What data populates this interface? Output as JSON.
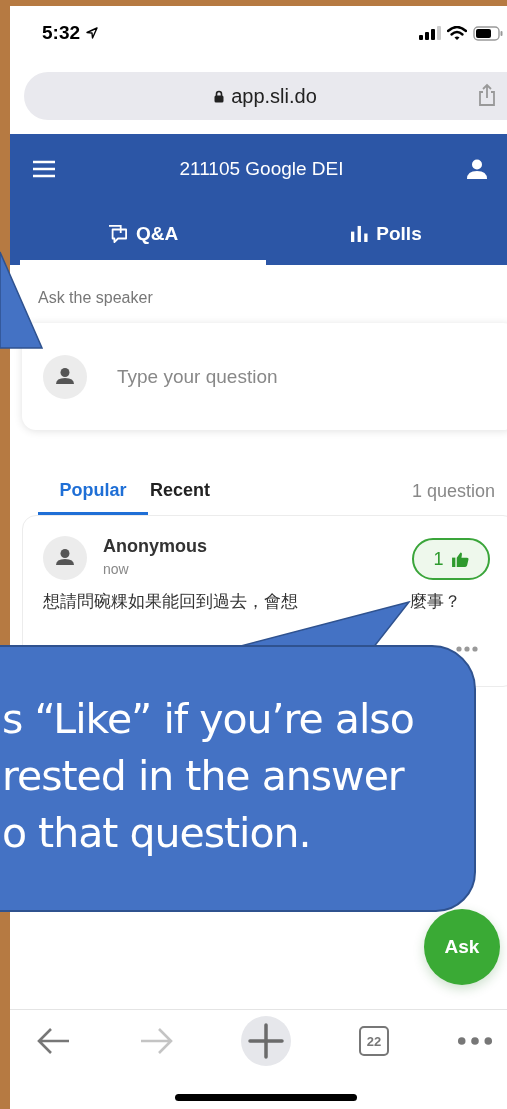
{
  "status_bar": {
    "time": "5:32"
  },
  "browser": {
    "url": "app.sli.do"
  },
  "header": {
    "title": "211105 Google DEI"
  },
  "tabs": [
    {
      "label": "Q&A",
      "kind": "chat",
      "selected": true
    },
    {
      "label": "Polls",
      "kind": "bars",
      "selected": false
    }
  ],
  "ask": {
    "label": "Ask the speaker",
    "placeholder": "Type your question"
  },
  "sort_tabs": [
    {
      "label": "Popular",
      "selected": true
    },
    {
      "label": "Recent",
      "selected": false
    }
  ],
  "question_count": "1 question",
  "questions": [
    {
      "author": "Anonymous",
      "time": "now",
      "text_parts": [
        "想請問碗粿如果能回到過去，會想",
        "麼事？"
      ],
      "likes": "1",
      "liked": true
    }
  ],
  "callout": {
    "lines": [
      "s “Like” if you’re also",
      "rested in the answer",
      "o that question."
    ]
  },
  "ask_button": "Ask",
  "toolbar": {
    "forward_disabled": true,
    "tab_count": "22"
  }
}
